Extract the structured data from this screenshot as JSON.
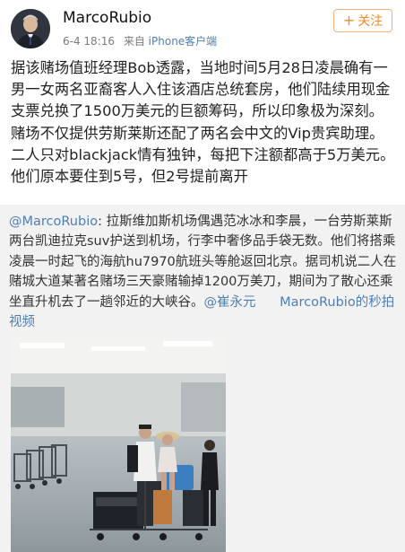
{
  "header": {
    "username": "MarcoRubio",
    "timestamp": "6-4 18:16",
    "source_prefix": "来自",
    "source_client": "iPhone客户端",
    "follow_label": "关注",
    "follow_icon": "plus-icon"
  },
  "post": {
    "text": "据该赌场值班经理Bob透露，当地时间5月28日凌晨确有一男一女两名亚裔客人入住该酒店总统套房，他们陆续用现金支票兑换了1500万美元的巨额筹码，所以印象极为深刻。赌场不仅提供劳斯莱斯还配了两名会中文的Vip贵宾助理。二人只对blackjack情有独钟，每把下注额都高于5万美元。他们原本要住到5号，但2号提前离开"
  },
  "retweet": {
    "mention": "@MarcoRubio",
    "body": ": 拉斯维加斯机场偶遇范冰冰和李晨，一台劳斯莱斯两台凯迪拉克suv护送到机场，行李中奢侈品手袋无数。他们将搭乘凌晨一时起飞的海航hu7970航班头等舱返回北京。据司机说二人在赌城大道某著名赌场三天豪赌输掉1200万美刀，期间为了散心还乘坐直升机去了一趟邻近的大峡谷。",
    "mention2": "@崔永元",
    "video_link": "MarcoRubio的秒拍视频"
  },
  "colors": {
    "link": "#4e7fb3",
    "follow_border": "#f1b57d",
    "follow_text": "#ef8a2c",
    "retweet_bg": "#f2f2f2"
  }
}
